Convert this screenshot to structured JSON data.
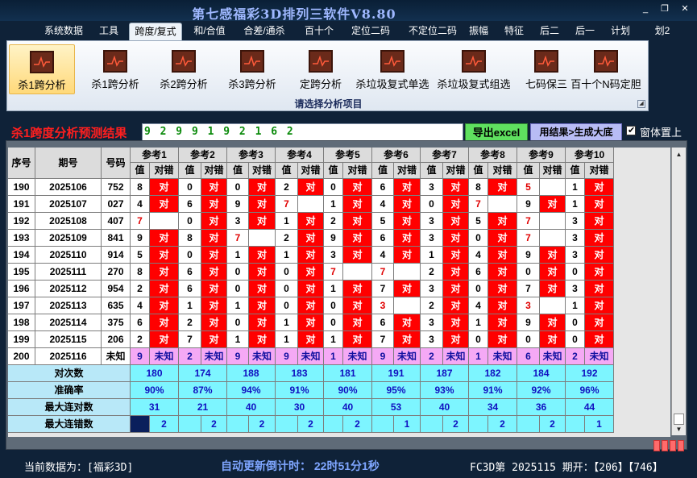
{
  "app": {
    "title": "第七感福彩3D排列三软件V8.80"
  },
  "window_controls": [
    "_",
    "❐",
    "✕"
  ],
  "menu": [
    {
      "label": "系统数据",
      "active": false
    },
    {
      "label": "工具",
      "active": false
    },
    {
      "label": "跨度/复式",
      "active": true
    },
    {
      "label": "和/合值",
      "active": false
    },
    {
      "label": "合差/通杀",
      "active": false
    },
    {
      "label": "百十个",
      "active": false
    },
    {
      "label": "定位二码",
      "active": false
    },
    {
      "label": "不定位二码",
      "active": false
    },
    {
      "label": "振幅",
      "active": false
    },
    {
      "label": "特征",
      "active": false
    },
    {
      "label": "后二",
      "active": false
    },
    {
      "label": "后一",
      "active": false
    },
    {
      "label": "计划",
      "active": false
    },
    {
      "label": "划2",
      "active": false
    }
  ],
  "ribbon": {
    "caption": "请选择分析项目",
    "buttons": [
      {
        "label": "杀1跨分析",
        "active": true
      },
      {
        "label": "杀1跨分析",
        "active": false
      },
      {
        "label": "杀2跨分析",
        "active": false
      },
      {
        "label": "杀3跨分析",
        "active": false
      },
      {
        "label": "定跨分析",
        "active": false
      },
      {
        "label": "杀垃圾复式单选",
        "active": false
      },
      {
        "label": "杀垃圾复式组选",
        "active": false
      },
      {
        "label": "七码保三",
        "active": false
      },
      {
        "label": "百十个N码定胆",
        "active": false
      }
    ]
  },
  "result": {
    "label": "杀1跨度分析预测结果",
    "value": "9 2 9 9 1 9 2 1 6 2",
    "excel_button": "导出excel",
    "generate_button": "用结果>生成大底",
    "pin_checked": true,
    "pin_label": "窗体置上"
  },
  "table": {
    "headers": {
      "seq": "序号",
      "period": "期号",
      "code": "号码",
      "val": "值",
      "check": "对错"
    },
    "refs": [
      "参考1",
      "参考2",
      "参考3",
      "参考4",
      "参考5",
      "参考6",
      "参考7",
      "参考8",
      "参考9",
      "参考10"
    ],
    "right": "对",
    "rows": [
      {
        "seq": "190",
        "period": "2025106",
        "code": "752",
        "vals": [
          8,
          0,
          0,
          2,
          0,
          6,
          3,
          8,
          5,
          1
        ],
        "ok": [
          1,
          1,
          1,
          1,
          1,
          1,
          1,
          1,
          0,
          1
        ],
        "red": [
          0,
          0,
          0,
          0,
          0,
          0,
          0,
          0,
          1,
          0
        ]
      },
      {
        "seq": "191",
        "period": "2025107",
        "code": "027",
        "vals": [
          4,
          6,
          9,
          7,
          1,
          4,
          0,
          7,
          9,
          1
        ],
        "ok": [
          1,
          1,
          1,
          0,
          1,
          1,
          1,
          0,
          1,
          1
        ],
        "red": [
          0,
          0,
          0,
          1,
          0,
          0,
          0,
          1,
          0,
          0
        ]
      },
      {
        "seq": "192",
        "period": "2025108",
        "code": "407",
        "vals": [
          7,
          0,
          3,
          1,
          2,
          5,
          3,
          5,
          7,
          3
        ],
        "ok": [
          0,
          1,
          1,
          1,
          1,
          1,
          1,
          1,
          0,
          1
        ],
        "red": [
          1,
          0,
          0,
          0,
          0,
          0,
          0,
          0,
          1,
          0
        ]
      },
      {
        "seq": "193",
        "period": "2025109",
        "code": "841",
        "vals": [
          9,
          8,
          7,
          2,
          9,
          6,
          3,
          0,
          7,
          3
        ],
        "ok": [
          1,
          1,
          0,
          1,
          1,
          1,
          1,
          1,
          0,
          1
        ],
        "red": [
          0,
          0,
          1,
          0,
          0,
          0,
          0,
          0,
          1,
          0
        ]
      },
      {
        "seq": "194",
        "period": "2025110",
        "code": "914",
        "vals": [
          5,
          0,
          1,
          1,
          3,
          4,
          1,
          4,
          9,
          3
        ],
        "ok": [
          1,
          1,
          1,
          1,
          1,
          1,
          1,
          1,
          1,
          1
        ],
        "red": [
          0,
          0,
          0,
          0,
          0,
          0,
          0,
          0,
          0,
          0
        ]
      },
      {
        "seq": "195",
        "period": "2025111",
        "code": "270",
        "vals": [
          8,
          6,
          0,
          0,
          7,
          7,
          2,
          6,
          0,
          0
        ],
        "ok": [
          1,
          1,
          1,
          1,
          0,
          0,
          1,
          1,
          1,
          1
        ],
        "red": [
          0,
          0,
          0,
          0,
          1,
          1,
          0,
          0,
          0,
          0
        ]
      },
      {
        "seq": "196",
        "period": "2025112",
        "code": "954",
        "vals": [
          2,
          6,
          0,
          0,
          1,
          7,
          3,
          0,
          7,
          3
        ],
        "ok": [
          1,
          1,
          1,
          1,
          1,
          1,
          1,
          1,
          1,
          1
        ],
        "red": [
          0,
          0,
          0,
          0,
          0,
          0,
          0,
          0,
          0,
          0
        ]
      },
      {
        "seq": "197",
        "period": "2025113",
        "code": "635",
        "vals": [
          4,
          1,
          1,
          0,
          0,
          3,
          2,
          4,
          3,
          1
        ],
        "ok": [
          1,
          1,
          1,
          1,
          1,
          0,
          1,
          1,
          0,
          1
        ],
        "red": [
          0,
          0,
          0,
          0,
          0,
          1,
          0,
          0,
          1,
          0
        ]
      },
      {
        "seq": "198",
        "period": "2025114",
        "code": "375",
        "vals": [
          6,
          2,
          0,
          1,
          0,
          6,
          3,
          1,
          9,
          0
        ],
        "ok": [
          1,
          1,
          1,
          1,
          1,
          1,
          1,
          1,
          1,
          1
        ],
        "red": [
          0,
          0,
          0,
          0,
          0,
          0,
          0,
          0,
          0,
          0
        ]
      },
      {
        "seq": "199",
        "period": "2025115",
        "code": "206",
        "vals": [
          2,
          7,
          1,
          1,
          1,
          7,
          3,
          0,
          0,
          0
        ],
        "ok": [
          1,
          1,
          1,
          1,
          1,
          1,
          1,
          1,
          1,
          1
        ],
        "red": [
          0,
          0,
          0,
          0,
          0,
          0,
          0,
          0,
          0,
          0
        ]
      }
    ],
    "pending": {
      "seq": "200",
      "period": "2025116",
      "code": "未知",
      "vals": [
        9,
        2,
        9,
        9,
        1,
        9,
        2,
        1,
        6,
        2
      ],
      "mark": "未知"
    },
    "stats": [
      {
        "label": "对次数",
        "values": [
          "180",
          "174",
          "188",
          "183",
          "181",
          "191",
          "187",
          "182",
          "184",
          "192"
        ]
      },
      {
        "label": "准确率",
        "values": [
          "90%",
          "87%",
          "94%",
          "91%",
          "90%",
          "95%",
          "93%",
          "91%",
          "92%",
          "96%"
        ]
      },
      {
        "label": "最大连对数",
        "values": [
          "31",
          "21",
          "40",
          "30",
          "40",
          "53",
          "40",
          "34",
          "36",
          "44"
        ]
      },
      {
        "label": "最大连错数",
        "values": [
          "2",
          "2",
          "2",
          "2",
          "2",
          "1",
          "2",
          "2",
          "2",
          "1"
        ]
      }
    ]
  },
  "colors": {
    "right": "#ff0000",
    "pending": "#f5a9f5",
    "stats": "#7df5ff"
  },
  "status": {
    "left": "当前数据为：[福彩3D]",
    "middle": "自动更新倒计时：  22时51分1秒",
    "right": "FC3D第 2025115 期开：【206】【746】"
  }
}
